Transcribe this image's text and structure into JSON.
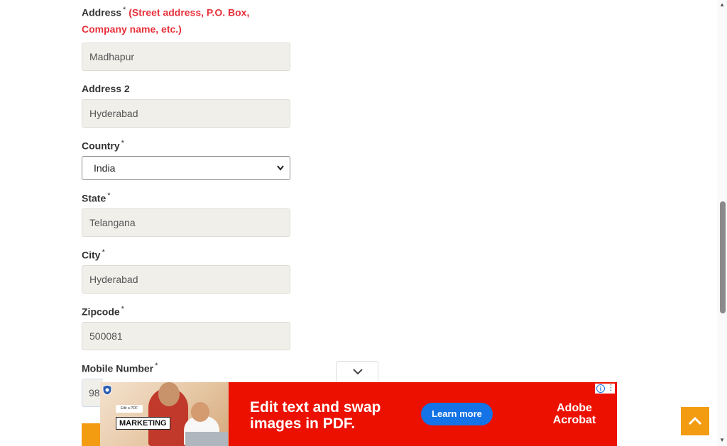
{
  "form": {
    "address": {
      "label": "Address",
      "required": "*",
      "hint_line1": "(Street address, P.O. Box,",
      "hint_line2": "Company name, etc.)",
      "value": "Madhapur"
    },
    "address2": {
      "label": "Address 2",
      "value": "Hyderabad"
    },
    "country": {
      "label": "Country",
      "required": "*",
      "value": "India"
    },
    "state": {
      "label": "State",
      "required": "*",
      "value": "Telangana"
    },
    "city": {
      "label": "City",
      "required": "*",
      "value": "Hyderabad"
    },
    "zipcode": {
      "label": "Zipcode",
      "required": "*",
      "value": "500081"
    },
    "mobile": {
      "label": "Mobile Number",
      "required": "*",
      "value_visible": "98"
    }
  },
  "ad": {
    "edit_tag": "Edit a PDF",
    "marketing_label": "MARKETING",
    "headline_line1": "Edit text and swap",
    "headline_line2": "images in PDF.",
    "cta": "Learn more",
    "brand_line1": "Adobe",
    "brand_line2": "Acrobat",
    "adchoices_icon": "i",
    "menu_icon": "⋮"
  },
  "colors": {
    "accent_orange": "#f39c12",
    "hint_red": "#e8303b",
    "ad_red": "#eb1000",
    "cta_blue": "#1473e6"
  },
  "icons": [
    "chevron-down-icon",
    "chevron-up-icon",
    "shield-icon",
    "adchoices-icon",
    "more-vert-icon"
  ]
}
